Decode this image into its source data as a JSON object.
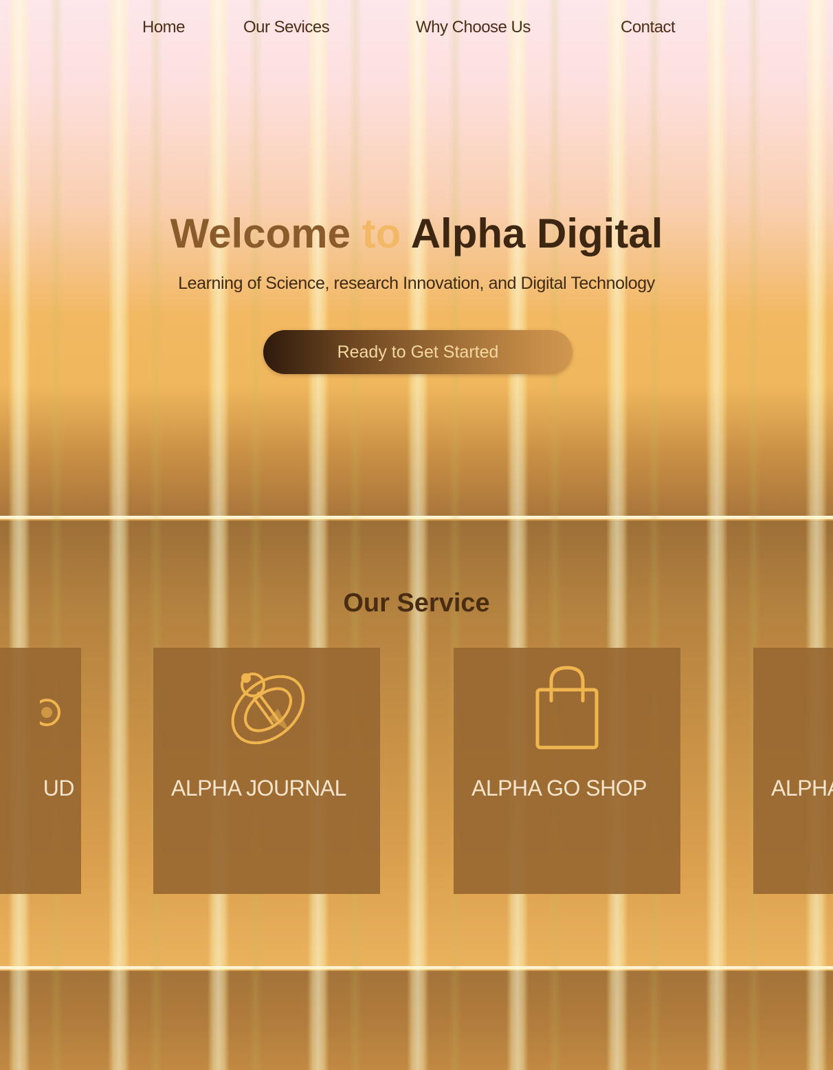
{
  "nav": {
    "items": [
      {
        "label": "Home"
      },
      {
        "label": "Our Sevices"
      },
      {
        "label": "Why Choose Us"
      },
      {
        "label": "Contact"
      }
    ]
  },
  "hero": {
    "title_part1": "Welcome ",
    "title_part2": "to ",
    "title_part3": "Alpha Digital",
    "subtitle": "Learning of Science, research Innovation, and Digital Technology",
    "cta_label": "Ready to Get Started"
  },
  "services": {
    "title": "Our Service",
    "cards": [
      {
        "title": "UD",
        "description": "",
        "icon": "cloud-icon"
      },
      {
        "title": "ALPHA JOURNAL",
        "description": "",
        "icon": "planet-journal-icon"
      },
      {
        "title": "ALPHA GO SHOP",
        "description": "",
        "icon": "shopping-bag-icon"
      },
      {
        "title": "ALPHA",
        "description": "",
        "icon": "document-icon"
      }
    ]
  },
  "colors": {
    "accent": "#f2b865",
    "dark_text": "#3d2612",
    "card_bg": "#986832",
    "icon_stroke": "#f0b54f"
  }
}
